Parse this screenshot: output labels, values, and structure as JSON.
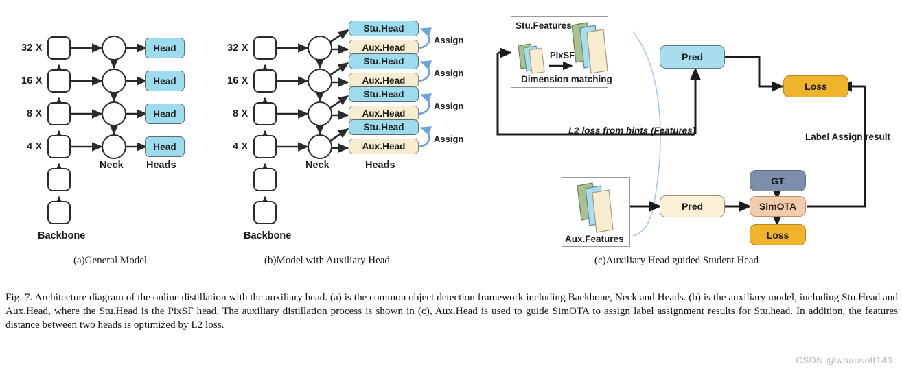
{
  "figure": {
    "panels": [
      {
        "id": "a",
        "caption": "(a)General Model",
        "scale_labels": [
          "32 X",
          "16 X",
          "8 X",
          "4 X"
        ],
        "column_captions": {
          "backbone": "Backbone",
          "neck": "Neck",
          "heads": "Heads"
        },
        "heads": [
          "Head",
          "Head",
          "Head",
          "Head"
        ]
      },
      {
        "id": "b",
        "caption": "(b)Model with Auxiliary Head",
        "scale_labels": [
          "32 X",
          "16 X",
          "8 X",
          "4 X"
        ],
        "column_captions": {
          "backbone": "Backbone",
          "neck": "Neck",
          "heads": "Heads"
        },
        "head_pairs": [
          {
            "stu": "Stu.Head",
            "aux": "Aux.Head",
            "assign": "Assign"
          },
          {
            "stu": "Stu.Head",
            "aux": "Aux.Head",
            "assign": "Assign"
          },
          {
            "stu": "Stu.Head",
            "aux": "Aux.Head",
            "assign": "Assign"
          },
          {
            "stu": "Stu.Head",
            "aux": "Aux.Head",
            "assign": "Assign"
          }
        ]
      },
      {
        "id": "c",
        "caption": "(c)Auxiliary Head guided Student Head",
        "stu_features_title": "Stu.Features",
        "stu_features_subtitle": "Dimension matching",
        "pixsf_label": "PixSF",
        "aux_features_title": "Aux.Features",
        "pred_top": "Pred",
        "pred_bottom": "Pred",
        "loss_top": "Loss",
        "loss_bottom": "Loss",
        "gt": "GT",
        "simota": "SimOTA",
        "l2_label": "L2 loss from hints (Features)",
        "label_assign_label": "Label Assign result"
      }
    ],
    "caption_text": "Fig. 7.  Architecture diagram of the online distillation with the auxiliary head. (a) is the common object detection framework including Backbone, Neck and Heads. (b) is the auxiliary model, including Stu.Head and Aux.Head, where the Stu.Head is the PixSF head. The auxiliary distillation process is shown in (c), Aux.Head is used to guide SimOTA to assign label assignment results for Stu.head. In addition, the features distance between two heads is optimized by L2 loss.",
    "watermark": "CSDN @whaosoft143"
  },
  "colors": {
    "head_blue": "#9ddcef",
    "aux_cream": "#f7ecd0",
    "loss_amber": "#f0b42c",
    "gt_slate": "#7e8da9",
    "simota_peach": "#f5cbad",
    "feature_green": "#a9c28d",
    "feature_blue": "#a8ddf0",
    "feature_cream": "#f7ecd0",
    "assign_arrow": "#6ba3dd",
    "hint_curve": "#a9c8e8",
    "stroke": "#2b2b2b"
  }
}
